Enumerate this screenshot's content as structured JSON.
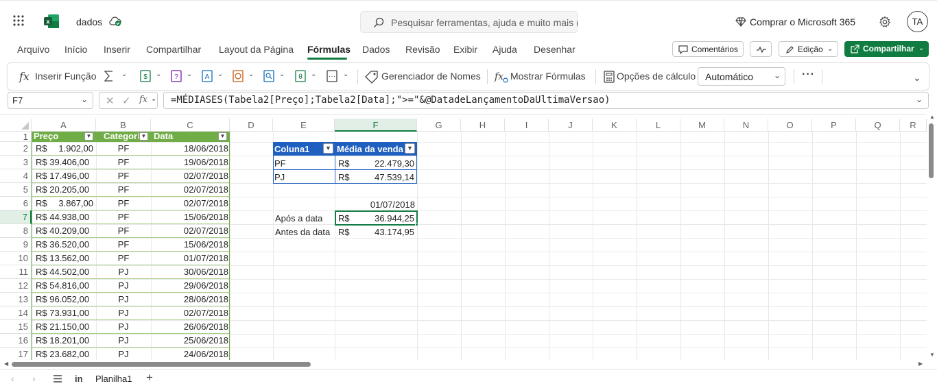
{
  "titlebar": {
    "doc_name": "dados",
    "search_placeholder": "Pesquisar ferramentas, ajuda e muito mais (Alt + Q)",
    "buy": "Comprar o Microsoft 365",
    "avatar": "TA"
  },
  "menu": {
    "items": [
      "Arquivo",
      "Início",
      "Inserir",
      "Compartilhar",
      "Layout da Página",
      "Fórmulas",
      "Dados",
      "Revisão",
      "Exibir",
      "Ajuda",
      "Desenhar"
    ],
    "comments": "Comentários",
    "editing": "Edição",
    "share": "Compartilhar"
  },
  "ribbon": {
    "insert_function": "Inserir Função",
    "name_manager": "Gerenciador de Nomes",
    "show_formulas": "Mostrar Fórmulas",
    "calc_options": "Opções de cálculo",
    "calc_mode": "Automático"
  },
  "formula_bar": {
    "name_box": "F7",
    "fx": "fx",
    "formula": "=MÉDIASES(Tabela2[Preço];Tabela2[Data];\">=\"&@DatadeLançamentoDaUltimaVersao)"
  },
  "grid": {
    "columns": [
      "A",
      "B",
      "C",
      "D",
      "E",
      "F",
      "G",
      "H",
      "I",
      "J",
      "K",
      "L",
      "M",
      "N",
      "O",
      "P",
      "Q",
      "R"
    ],
    "rows": [
      "1",
      "2",
      "3",
      "4",
      "5",
      "6",
      "7",
      "8",
      "9",
      "10",
      "11",
      "12",
      "13",
      "14",
      "15",
      "16",
      "17"
    ],
    "table_headers": [
      "Preço",
      "Categori",
      "Data"
    ],
    "table_rows": [
      [
        "R$",
        "1.902,00",
        "PF",
        "18/06/2018"
      ],
      [
        "R$ 39.406,00",
        "",
        "PF",
        "19/06/2018"
      ],
      [
        "R$ 17.496,00",
        "",
        "PF",
        "02/07/2018"
      ],
      [
        "R$ 20.205,00",
        "",
        "PF",
        "02/07/2018"
      ],
      [
        "R$",
        "3.867,00",
        "PF",
        "02/07/2018"
      ],
      [
        "R$ 44.938,00",
        "",
        "PF",
        "15/06/2018"
      ],
      [
        "R$ 40.209,00",
        "",
        "PF",
        "02/07/2018"
      ],
      [
        "R$ 36.520,00",
        "",
        "PF",
        "15/06/2018"
      ],
      [
        "R$ 13.562,00",
        "",
        "PF",
        "01/07/2018"
      ],
      [
        "R$ 44.502,00",
        "",
        "PJ",
        "30/06/2018"
      ],
      [
        "R$ 54.816,00",
        "",
        "PJ",
        "29/06/2018"
      ],
      [
        "R$ 96.052,00",
        "",
        "PJ",
        "28/06/2018"
      ],
      [
        "R$ 73.931,00",
        "",
        "PJ",
        "02/07/2018"
      ],
      [
        "R$ 21.150,00",
        "",
        "PJ",
        "26/06/2018"
      ],
      [
        "R$ 18.201,00",
        "",
        "PJ",
        "25/06/2018"
      ],
      [
        "R$ 23.682,00",
        "",
        "PJ",
        "24/06/2018"
      ]
    ],
    "summary": {
      "h1": "Coluna1",
      "h2": "Média da venda",
      "r1_label": "PF",
      "r1_cur": "R$",
      "r1_val": "22.479,30",
      "r2_label": "PJ",
      "r2_cur": "R$",
      "r2_val": "47.539,14"
    },
    "date_cell": "01/07/2018",
    "after_label": "Após a data",
    "after_cur": "R$",
    "after_val": "36.944,25",
    "before_label": "Antes da data",
    "before_cur": "R$",
    "before_val": "43.174,95"
  },
  "sheet_tabs": {
    "active": "Planilha1"
  },
  "colors": {
    "green": "#107c41",
    "table_header": "#70ad47",
    "summary_header": "#1f5fbf"
  }
}
